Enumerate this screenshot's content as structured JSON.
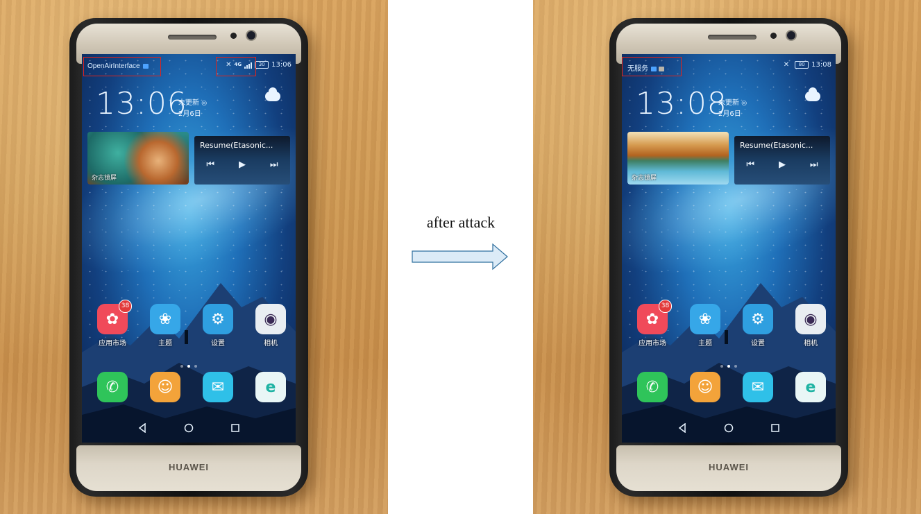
{
  "caption": "after attack",
  "phone_before": {
    "carrier": "OpenAirInterface",
    "network_type": "4G",
    "battery": "30",
    "status_time": "13:06",
    "clock": "13:06",
    "update_status": "未更新",
    "date": "2月6日",
    "magazine_label": "杂志锁屏",
    "music_title": "Resume(Etasonic...",
    "brand": "HUAWEI"
  },
  "phone_after": {
    "carrier": "无服务",
    "network_type": "",
    "battery": "80",
    "status_time": "13:08",
    "clock": "13:08",
    "update_status": "未更新",
    "date": "2月6日",
    "magazine_label": "杂志锁屏",
    "music_title": "Resume(Etasonic...",
    "brand": "HUAWEI"
  },
  "apps": [
    {
      "label": "应用市场",
      "icon": "huawei-appgallery-icon",
      "color": "#f04a5a",
      "badge": "38"
    },
    {
      "label": "主题",
      "icon": "flower-theme-icon",
      "color": "#36a7e8",
      "badge": ""
    },
    {
      "label": "设置",
      "icon": "gear-icon",
      "color": "#2f9fe0",
      "badge": ""
    },
    {
      "label": "相机",
      "icon": "camera-icon",
      "color": "#e9eef2",
      "badge": ""
    }
  ],
  "dock": [
    {
      "icon": "phone-icon",
      "color": "#2fc45a"
    },
    {
      "icon": "contacts-icon",
      "color": "#f3a33a"
    },
    {
      "icon": "messages-icon",
      "color": "#2fc0e8"
    },
    {
      "icon": "browser-icon",
      "color": "#e9f6f6"
    }
  ],
  "colors": {
    "highlight_box": "#e0241c",
    "arrow_fill": "#dcebf7",
    "arrow_stroke": "#2e6f9e"
  }
}
